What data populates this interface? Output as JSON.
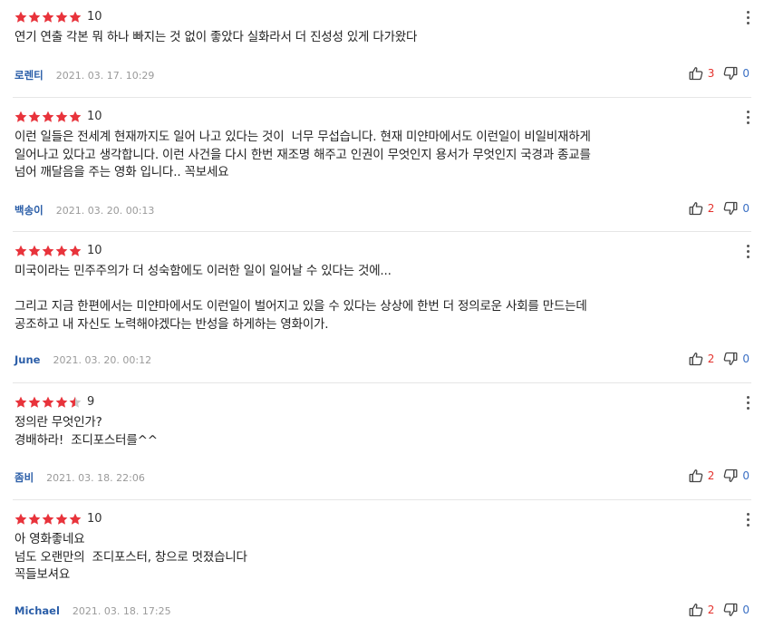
{
  "colors": {
    "star_on": "#e8333b",
    "star_off": "#c9c9c9",
    "nickname": "#2b5ea8",
    "like": "#e4322d",
    "dislike": "#3a6fc4"
  },
  "icons": {
    "star": "star-icon",
    "more": "more-vertical-icon",
    "like": "thumbs-up-icon",
    "dislike": "thumbs-down-icon"
  },
  "reviews": [
    {
      "rating": 10,
      "stars": 5,
      "score": "10",
      "lines": [
        "연기 연출 각본 뭐 하나 빠지는 것 없이 좋았다 실화라서 더 진성성 있게 다가왔다"
      ],
      "nickname": "로렌티",
      "date": "2021. 03. 17. 10:29",
      "likes": "3",
      "dislikes": "0"
    },
    {
      "rating": 10,
      "stars": 5,
      "score": "10",
      "lines": [
        "이런 일들은 전세계 현재까지도 일어 나고 있다는 것이  너무 무섭습니다. 현재 미얀마에서도 이런일이 비일비재하게",
        "일어나고 있다고 생각합니다. 이런 사건을 다시 한번 재조명 해주고 인권이 무엇인지 용서가 무엇인지 국경과 종교를",
        "넘어 깨달음을 주는 영화 입니다.. 꼭보세요"
      ],
      "nickname": "백송이",
      "date": "2021. 03. 20. 00:13",
      "likes": "2",
      "dislikes": "0"
    },
    {
      "rating": 10,
      "stars": 5,
      "score": "10",
      "lines": [
        "미국이라는 민주주의가 더 성숙함에도 이러한 일이 일어날 수 있다는 것에...",
        "",
        "그리고 지금 한편에서는 미얀마에서도 이런일이 벌어지고 있을 수 있다는 상상에 한번 더 정의로운 사회를 만드는데",
        "공조하고 내 자신도 노력해야겠다는 반성을 하게하는 영화이가."
      ],
      "nickname": "June",
      "date": "2021. 03. 20. 00:12",
      "likes": "2",
      "dislikes": "0"
    },
    {
      "rating": 9,
      "stars": 4.5,
      "score": "9",
      "lines": [
        "정의란 무엇인가?",
        "경배하라!  조디포스터를^^"
      ],
      "nickname": "좀비",
      "date": "2021. 03. 18. 22:06",
      "likes": "2",
      "dislikes": "0"
    },
    {
      "rating": 10,
      "stars": 5,
      "score": "10",
      "lines": [
        "아 영화좋네요",
        "넘도 오랜만의  조디포스터, 창으로 멋졌습니다",
        "꼭들보셔요"
      ],
      "nickname": "Michael",
      "date": "2021. 03. 18. 17:25",
      "likes": "2",
      "dislikes": "0"
    }
  ]
}
